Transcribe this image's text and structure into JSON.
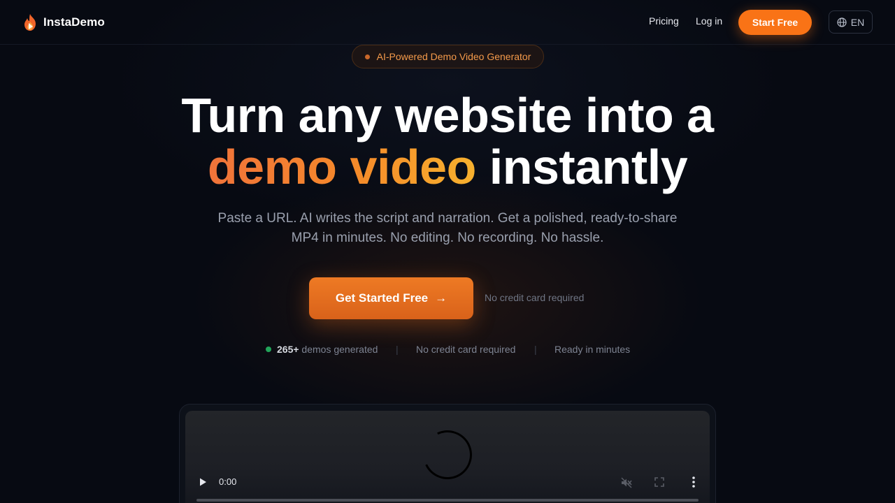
{
  "header": {
    "brand": "InstaDemo",
    "nav": {
      "pricing": "Pricing",
      "login": "Log in"
    },
    "start_button": "Start Free",
    "language": "EN"
  },
  "hero": {
    "badge": "AI-Powered Demo Video Generator",
    "title_line1": "Turn any website into a",
    "title_highlight": "demo video",
    "title_line2_rest": " instantly",
    "subtitle": "Paste a URL. AI writes the script and narration. Get a polished, ready-to-share MP4 in minutes. No editing. No recording. No hassle.",
    "cta_label": "Get Started Free",
    "cta_arrow": "→",
    "cta_note": "No credit card required"
  },
  "stats": {
    "demos_count": "265+",
    "demos_label": " demos generated",
    "no_cc": "No credit card required",
    "ready": "Ready in minutes",
    "separator": "|"
  },
  "video": {
    "time": "0:00",
    "progress": 0
  },
  "colors": {
    "accent": "#f97316",
    "background": "#070a12",
    "live_dot": "#22a55a"
  },
  "icons": [
    "flame-logo-icon",
    "globe-icon",
    "arrow-right-icon",
    "play-icon",
    "mute-icon",
    "fullscreen-icon",
    "more-options-icon"
  ]
}
